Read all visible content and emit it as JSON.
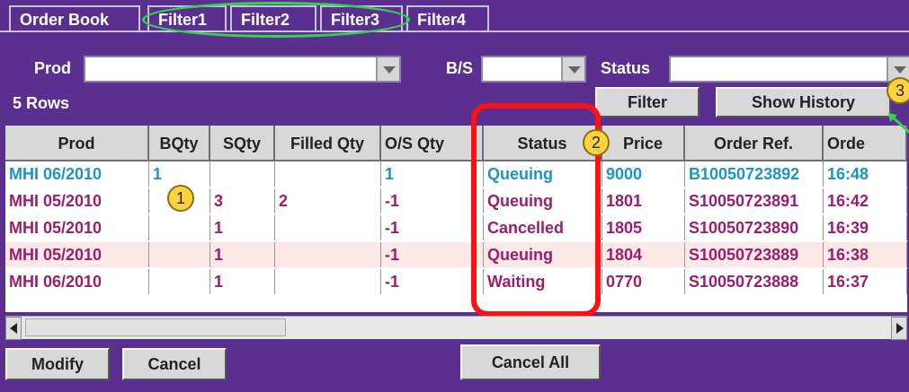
{
  "tabs": [
    {
      "label": "Order Book"
    },
    {
      "label": "Filter1"
    },
    {
      "label": "Filter2"
    },
    {
      "label": "Filter3"
    },
    {
      "label": "Filter4"
    }
  ],
  "filters": {
    "prod_label": "Prod",
    "bs_label": "B/S",
    "status_label": "Status",
    "prod_value": "",
    "bs_value": "",
    "status_value": ""
  },
  "rows_count": "5 Rows",
  "buttons": {
    "filter": "Filter",
    "show_history": "Show History"
  },
  "table": {
    "headers": [
      "Prod",
      "BQty",
      "SQty",
      "Filled Qty",
      "O/S Qty",
      "Status",
      "Price",
      "Order Ref.",
      "Orde"
    ],
    "rows": [
      {
        "prod": "MHI 06/2010",
        "bqty": "1",
        "sqty": "",
        "filled": "",
        "os": "1",
        "status": "Queuing",
        "price": "9000",
        "ref": "B10050723892",
        "time": "16:48"
      },
      {
        "prod": "MHI 05/2010",
        "bqty": "",
        "sqty": "3",
        "filled": "2",
        "os": "-1",
        "status": "Queuing",
        "price": "1801",
        "ref": "S10050723891",
        "time": "16:42"
      },
      {
        "prod": "MHI 05/2010",
        "bqty": "",
        "sqty": "1",
        "filled": "",
        "os": "-1",
        "status": "Cancelled",
        "price": "1805",
        "ref": "S10050723890",
        "time": "16:39"
      },
      {
        "prod": "MHI 05/2010",
        "bqty": "",
        "sqty": "1",
        "filled": "",
        "os": "-1",
        "status": "Queuing",
        "price": "1804",
        "ref": "S10050723889",
        "time": "16:38"
      },
      {
        "prod": "MHI 06/2010",
        "bqty": "",
        "sqty": "1",
        "filled": "",
        "os": "-1",
        "status": "Waiting",
        "price": "0770",
        "ref": "S10050723888",
        "time": "16:37"
      }
    ]
  },
  "badges": {
    "one": "1",
    "two": "2",
    "three": "3"
  },
  "bottom": {
    "modify": "Modify",
    "cancel": "Cancel",
    "cancel_all": "Cancel All"
  },
  "colors": {
    "background": "#5b2f8f",
    "teal_text": "#1a95c4",
    "magenta_text": "#9b1e6b",
    "annotation_red": "#ff1111",
    "annotation_green": "#34d34f",
    "badge_yellow": "#ffd33d"
  }
}
